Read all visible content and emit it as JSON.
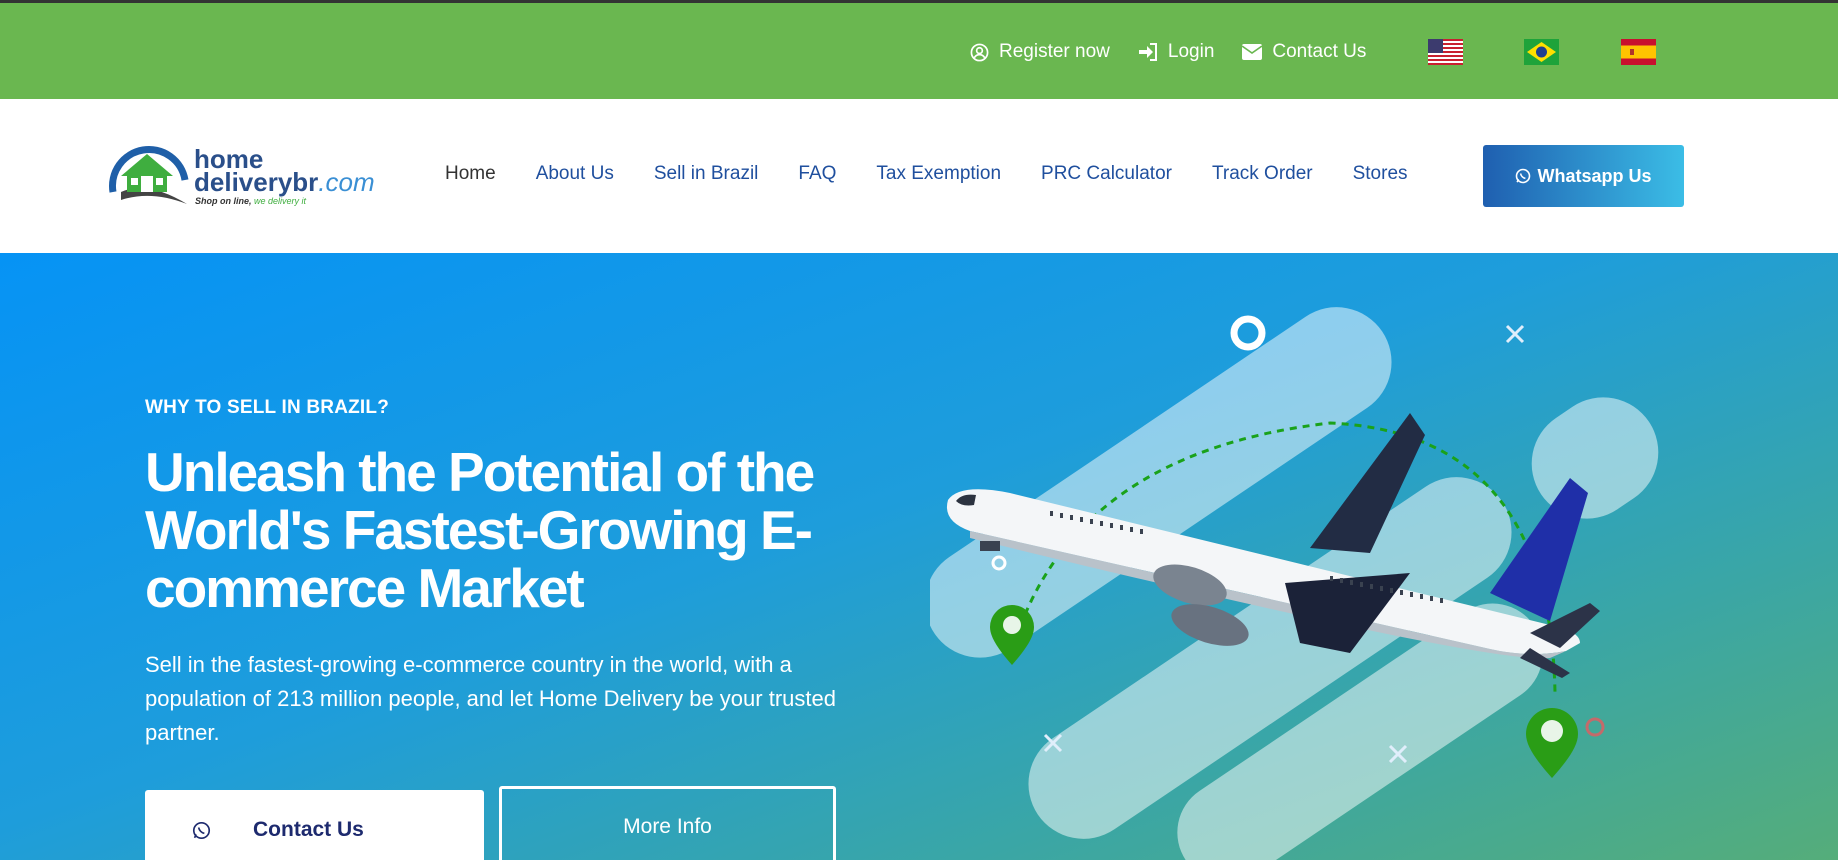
{
  "topbar": {
    "register_label": "Register now",
    "login_label": "Login",
    "contact_label": "Contact Us",
    "flags": [
      "us-flag-icon",
      "brazil-flag-icon",
      "spain-flag-icon"
    ]
  },
  "logo": {
    "line1": "home",
    "line2a": "deliverybr",
    "line2b": ".com",
    "tagline_a": "Shop on line, ",
    "tagline_b": "we delivery it"
  },
  "nav": {
    "items": [
      "Home",
      "About Us",
      "Sell in Brazil",
      "FAQ",
      "Tax Exemption",
      "PRC Calculator",
      "Track Order",
      "Stores"
    ],
    "whatsapp_label": "Whatsapp Us"
  },
  "hero": {
    "eyebrow": "WHY TO SELL IN BRAZIL?",
    "headline": "Unleash the Potential of the World's Fastest-Growing E-commerce Market",
    "subtext": "Sell in the fastest-growing e-commerce country in the world, with a population of 213 million people, and let Home Delivery be your trusted partner.",
    "contact_button": "Contact Us",
    "more_button": "More Info"
  },
  "colors": {
    "topbar": "#6ab750",
    "nav_link": "#1f4f9e",
    "hero_start": "#0693f5",
    "hero_end": "#55ad7a"
  }
}
